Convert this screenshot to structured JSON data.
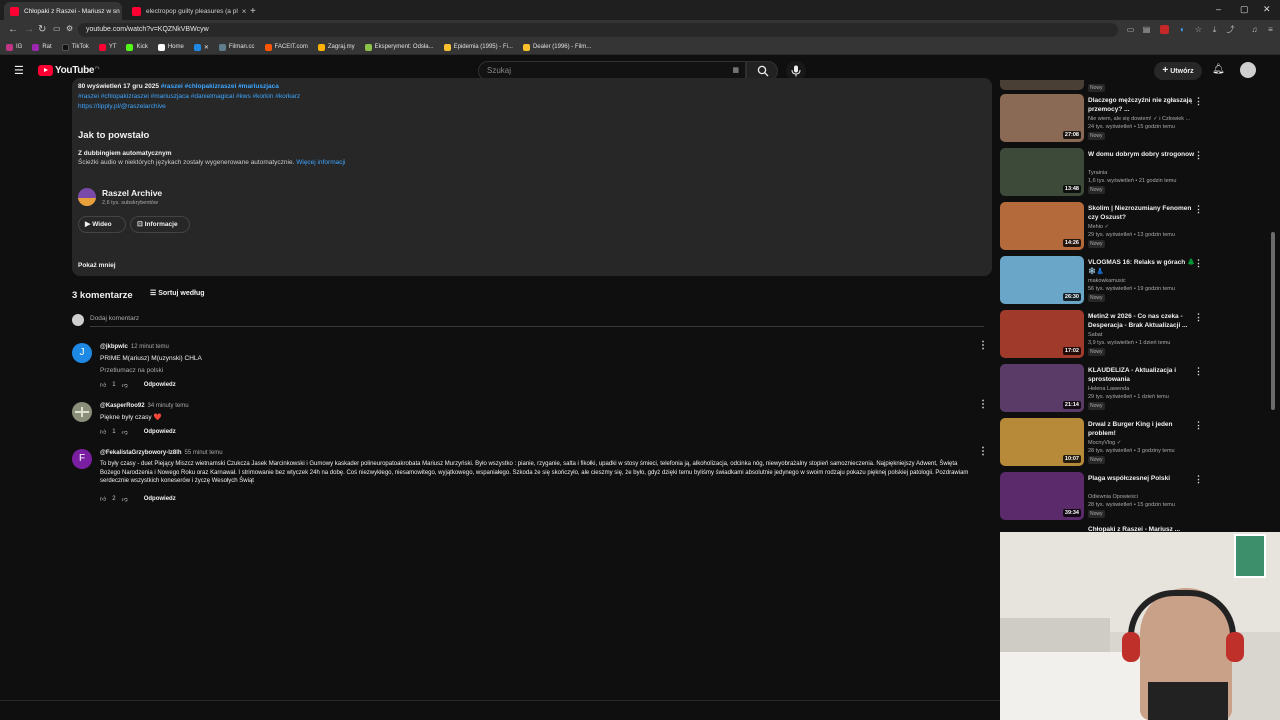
{
  "browser": {
    "tabs": [
      {
        "title": "Chłopaki z Raszei - Mariusz w sn"
      },
      {
        "title": "electropop guilty pleasures (a pl"
      }
    ],
    "url": "youtube.com/watch?v=KQZNkVBWcyw",
    "bookmarks": [
      "IG",
      "Rat",
      "TikTok",
      "YT",
      "Kick",
      "Home",
      "Filman.cc",
      "FACEIT.com",
      "Zagraj.my",
      "Eksperyment: Odsła...",
      "Epidemia (1995) - Fi...",
      "Dealer (1996) - Film..."
    ]
  },
  "youtube": {
    "logo": "YouTube",
    "logo_country": "PL",
    "search_placeholder": "Szukaj",
    "create_label": "Utwórz"
  },
  "description": {
    "stats": "80 wyświetleń  17 gru 2025",
    "stat_tags": "#raszei #chlopakizraszei #mariuszjaca",
    "tags_line": "#raszei #chlopakizraszei #mariuszjaca #danielmagical #kws #korkin #korkarz",
    "link": "https://tipply.pl/@raszelarchive",
    "how_made_heading": "Jak to powstało",
    "dubbing_title": "Z dubbingiem automatycznym",
    "dubbing_text": "Ścieżki audio w niektórych językach zostały wygenerowane automatycznie.",
    "dubbing_link": "Więcej informacji",
    "channel_name": "Raszel Archive",
    "channel_subs": "2,6 tys. subskrybentów",
    "btn_video": "Wideo",
    "btn_info": "Informacje",
    "show_less": "Pokaż mniej"
  },
  "comments": {
    "count_label": "3 komentarze",
    "sort_label": "Sortuj według",
    "add_placeholder": "Dodaj komentarz",
    "items": [
      {
        "avatar_letter": "J",
        "avatar_color": "#1e88e5",
        "author": "@jkbpwlc",
        "time": "12 minut temu",
        "text": "PRIME M(ariusz) M(uzynski) CHLA",
        "translate": "Przetłumacz na polski",
        "likes": "1",
        "reply": "Odpowiedz"
      },
      {
        "avatar_letter": "",
        "avatar_color": "#8a8f7a",
        "author": "@KasperRoo92",
        "time": "34 minuty temu",
        "text": "Piękne były czasy ❤️",
        "likes": "1",
        "reply": "Odpowiedz"
      },
      {
        "avatar_letter": "F",
        "avatar_color": "#7b1fa2",
        "author": "@FekalistaGrzybowory-lz8lh",
        "time": "55 minut temu",
        "text": "To były czasy - duet Piejący Miszcz wietnamski Czukcza Jasek Marcinkowski i Gumowy kaskader polineuropatoakrobata Mariusz Murzyński. Było wszystko : pianie, rzyganie, salta i fikołki, upadki w stosy śmieci, telefonia ją, alkoholizacja, odcinka nóg, niewyobrażalny stopień samoznieczenia. Najpiękniejszy Adwent, Święta Bożego Narodzenia i Nowego Roku oraz Karnawał. I strimowanie bez wtyczek 24h na dobę. Coś niezwykłego, niesamowitego, wyjątkowego, wspaniałego. Szkoda że się skończyło, ale cieszmy się, że było, gdyż dzięki temu byliśmy świadkami absolutnie jedynego w swoim rodzaju pokazu pięknej polskiej patologii. Pozdrawiam serdecznie wszystkich koneserów i życzę Wesołych Świąt",
        "likes": "2",
        "reply": "Odpowiedz"
      }
    ]
  },
  "sidebar": {
    "top_partial_badge": "Nowy",
    "videos": [
      {
        "title": "Dlaczego mężczyźni nie zgłaszają przemocy? ...",
        "channel": "Nie wiem, ale się dowiem! ✓ i Człowiek ...",
        "meta": "24 tys. wyświetleń • 15 godzin temu",
        "badge": "Nowy",
        "duration": "27:08",
        "color": "#8a6a55"
      },
      {
        "title": "W domu dobrym dobry strogonow",
        "channel": "Tyrainia",
        "meta": "1,6 tys. wyświetleń • 21 godzin temu",
        "badge": "Nowy",
        "duration": "13:48",
        "color": "#3d4a3a"
      },
      {
        "title": "Skolim | Niezrozumiany Fenomen czy Oszust?",
        "channel": "Mehio ✓",
        "meta": "29 tys. wyświetleń • 13 godzin temu",
        "badge": "Nowy",
        "duration": "14:26",
        "color": "#b56a3c"
      },
      {
        "title": "VLOGMAS 16: Relaks w górach 🌲❄️👗",
        "channel": "makowkamusic",
        "meta": "56 tys. wyświetleń • 19 godzin temu",
        "badge": "Nowy",
        "duration": "26:30",
        "color": "#6aa6c8"
      },
      {
        "title": "Metin2 w 2026 - Co nas czeka - Desperacja - Brak Aktualizacji ...",
        "channel": "Sabat",
        "meta": "3,9 tys. wyświetleń • 1 dzień temu",
        "badge": "Nowy",
        "duration": "17:02",
        "color": "#a03a2a"
      },
      {
        "title": "KLAUDELIZA - Aktualizacja i sprostowania",
        "channel": "Helena Lawenda",
        "meta": "29 tys. wyświetleń • 1 dzień temu",
        "badge": "Nowy",
        "duration": "21:14",
        "color": "#5a3a66"
      },
      {
        "title": "Drwal z Burger King i jeden problem!",
        "channel": "MocnyVlog ✓",
        "meta": "28 tys. wyświetleń • 3 godziny temu",
        "badge": "Nowy",
        "duration": "10:07",
        "color": "#b78a3a"
      },
      {
        "title": "Plaga współczesnej Polski",
        "channel": "Odlewnia Opowieści",
        "meta": "28 tys. wyświetleń • 15 godzin temu",
        "badge": "Nowy",
        "duration": "39:34",
        "color": "#5a2a6a"
      },
      {
        "title": "Chłopaki z Raszei - Mariusz ..."
      }
    ]
  }
}
